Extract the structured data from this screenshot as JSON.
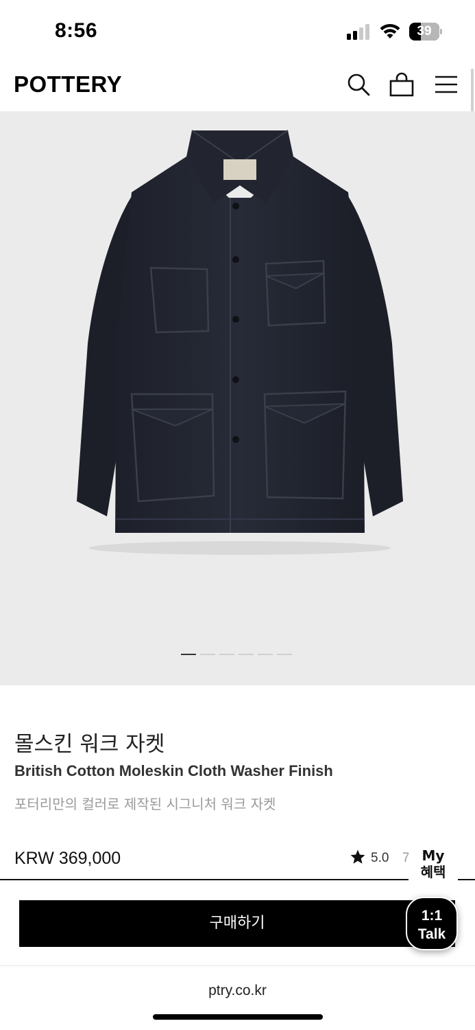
{
  "status_bar": {
    "time": "8:56",
    "battery": "39",
    "battery_level": 0.39
  },
  "header": {
    "logo": "POTTERY",
    "icons": [
      "search-icon",
      "shopping-bag-icon",
      "menu-icon"
    ]
  },
  "gallery": {
    "slide_count": 6,
    "active_index": 0,
    "background": "#ebebeb"
  },
  "product": {
    "name_ko": "몰스킨 워크 자켓",
    "name_en": "British Cotton Moleskin Cloth Washer Finish",
    "description": "포터리만의 컬러로 제작된 시그니처 워크 자켓",
    "price": "KRW 369,000",
    "rating": "5.0",
    "review_cut": "7"
  },
  "actions": {
    "buy_label": "구매하기",
    "my_benefit_line1": "My",
    "my_benefit_line2": "혜택",
    "talk_line1": "1:1",
    "talk_line2": "Talk"
  },
  "browser": {
    "url": "ptry.co.kr"
  },
  "colors": {
    "button": "#000000",
    "text": "#111111",
    "muted": "#9a9a9a"
  }
}
